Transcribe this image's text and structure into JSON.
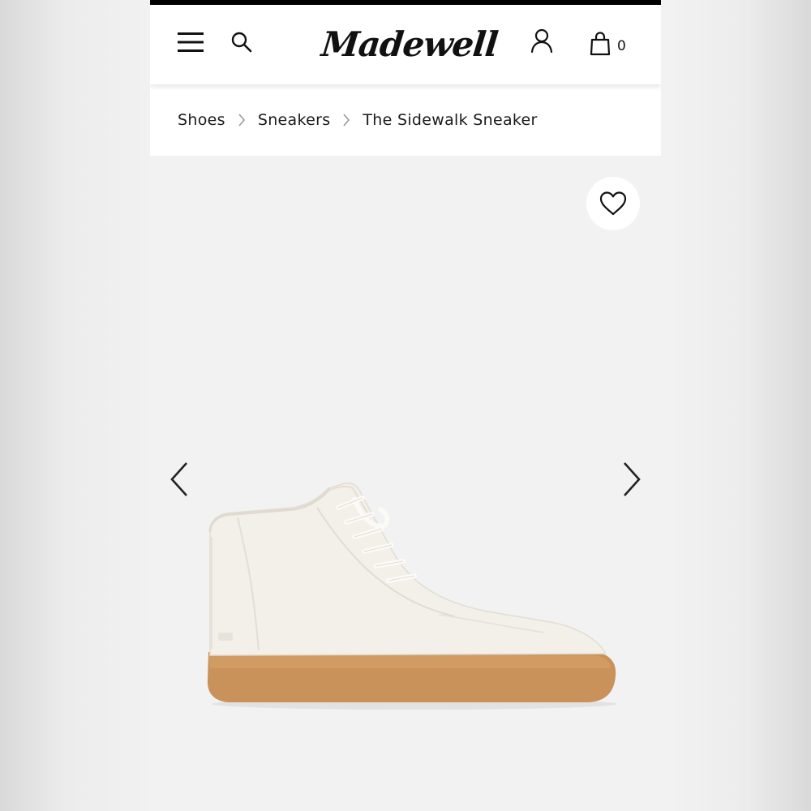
{
  "header": {
    "brand": "Madewell",
    "bag_count": "0"
  },
  "icons": {
    "menu": "menu-icon",
    "search": "search-icon",
    "account": "user-icon",
    "bag": "bag-icon",
    "favorite": "heart-icon",
    "prev": "chevron-left-icon",
    "next": "chevron-right-icon",
    "separator": "chevron-right-icon"
  },
  "breadcrumb": {
    "items": [
      "Shoes",
      "Sneakers",
      "The Sidewalk Sneaker"
    ]
  },
  "product": {
    "image_description": "white canvas high-top sneaker with gum sole",
    "colors": {
      "upper": "#f3efe9",
      "sole": "#c9925a",
      "background": "#f2f2f2"
    }
  }
}
